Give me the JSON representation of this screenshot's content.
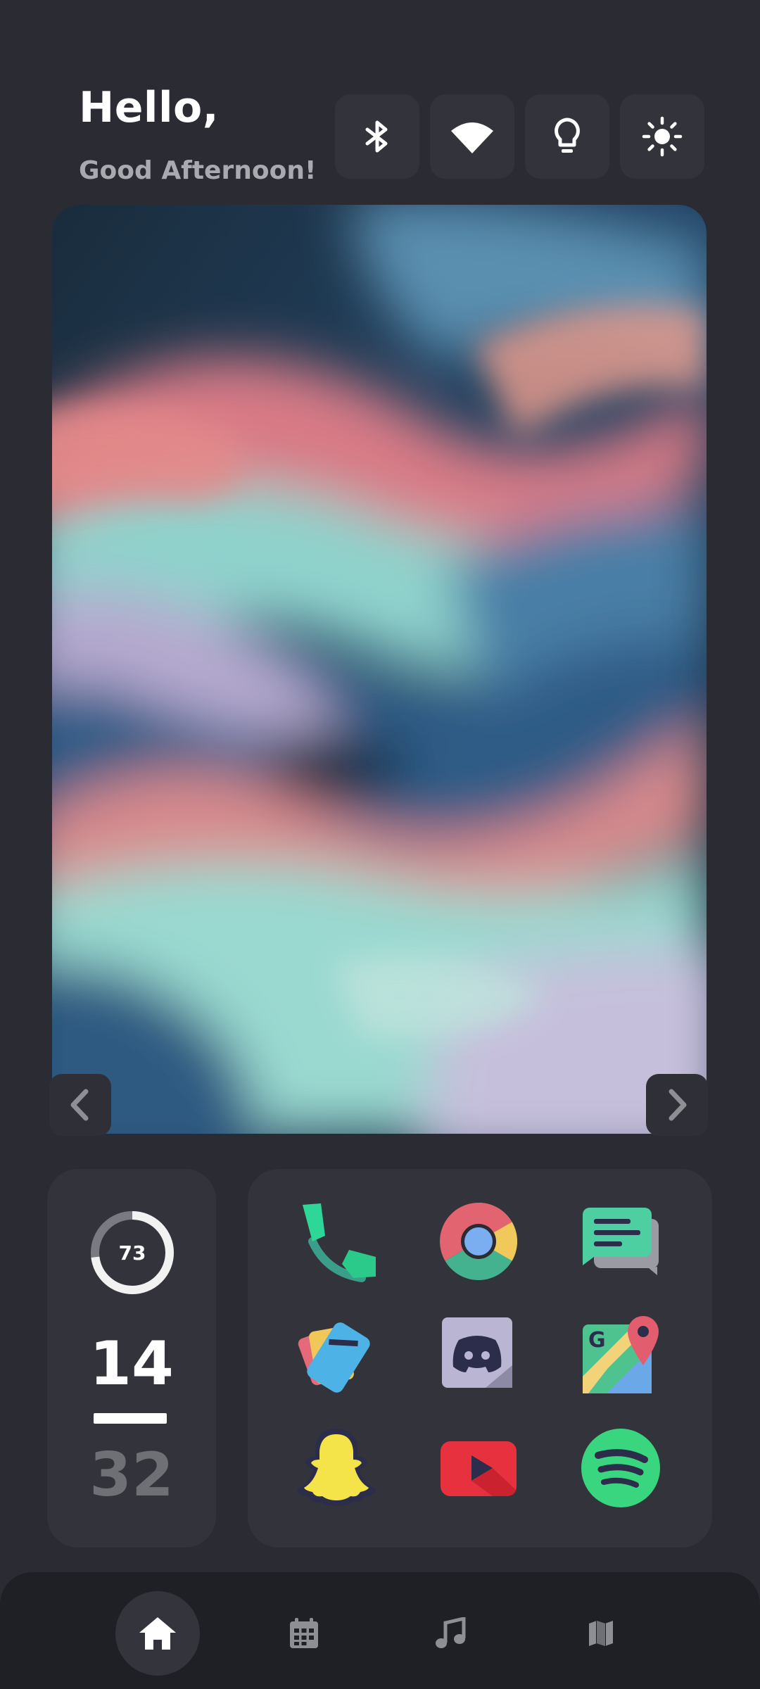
{
  "greeting": {
    "hello": "Hello,",
    "subtitle": "Good Afternoon!"
  },
  "quick_settings": [
    {
      "name": "bluetooth",
      "icon": "bluetooth-icon"
    },
    {
      "name": "wifi",
      "icon": "wifi-icon"
    },
    {
      "name": "flashlight",
      "icon": "lightbulb-icon"
    },
    {
      "name": "brightness",
      "icon": "sun-icon"
    }
  ],
  "wallpaper": {
    "prev_icon": "chevron-left-icon",
    "next_icon": "chevron-right-icon"
  },
  "stats": {
    "battery_percent": "73",
    "battery_fraction": 0.73,
    "hour": "14",
    "minute": "32"
  },
  "apps": [
    {
      "name": "phone",
      "icon": "phone-icon"
    },
    {
      "name": "chrome",
      "icon": "chrome-icon"
    },
    {
      "name": "messages",
      "icon": "messages-icon"
    },
    {
      "name": "wallet",
      "icon": "wallet-icon"
    },
    {
      "name": "discord",
      "icon": "discord-icon"
    },
    {
      "name": "maps",
      "icon": "maps-icon"
    },
    {
      "name": "snapchat",
      "icon": "snapchat-icon"
    },
    {
      "name": "youtube",
      "icon": "youtube-icon"
    },
    {
      "name": "spotify",
      "icon": "spotify-icon"
    }
  ],
  "bottom_nav": [
    {
      "name": "home",
      "icon": "home-icon",
      "active": true
    },
    {
      "name": "calendar",
      "icon": "calendar-icon",
      "active": false
    },
    {
      "name": "music",
      "icon": "music-note-icon",
      "active": false
    },
    {
      "name": "map",
      "icon": "map-icon",
      "active": false
    }
  ],
  "colors": {
    "background": "#2a2b33",
    "card": "#32333b",
    "text_primary": "#ffffff",
    "text_secondary": "#a9aab0"
  }
}
